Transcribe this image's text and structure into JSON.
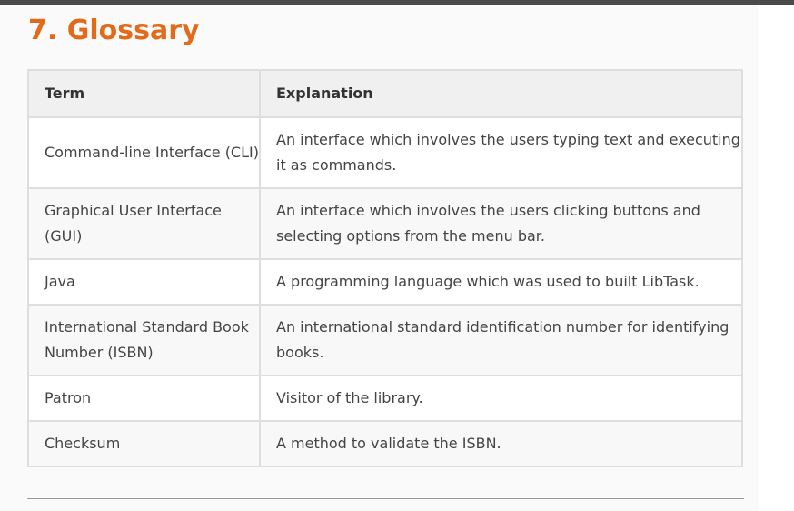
{
  "heading": "7. Glossary",
  "table": {
    "headers": [
      "Term",
      "Explanation"
    ],
    "rows": [
      {
        "term": "Command-line Interface (CLI)",
        "explanation": "An interface which involves the users typing text and executing it as commands."
      },
      {
        "term": "Graphical User Interface (GUI)",
        "explanation": "An interface which involves the users clicking buttons and selecting options from the menu bar."
      },
      {
        "term": "Java",
        "explanation": "A programming language which was used to built LibTask."
      },
      {
        "term": "International Standard Book Number (ISBN)",
        "explanation": "An international standard identification number for identifying books."
      },
      {
        "term": "Patron",
        "explanation": "Visitor of the library."
      },
      {
        "term": "Checksum",
        "explanation": "A method to validate the ISBN."
      }
    ]
  }
}
